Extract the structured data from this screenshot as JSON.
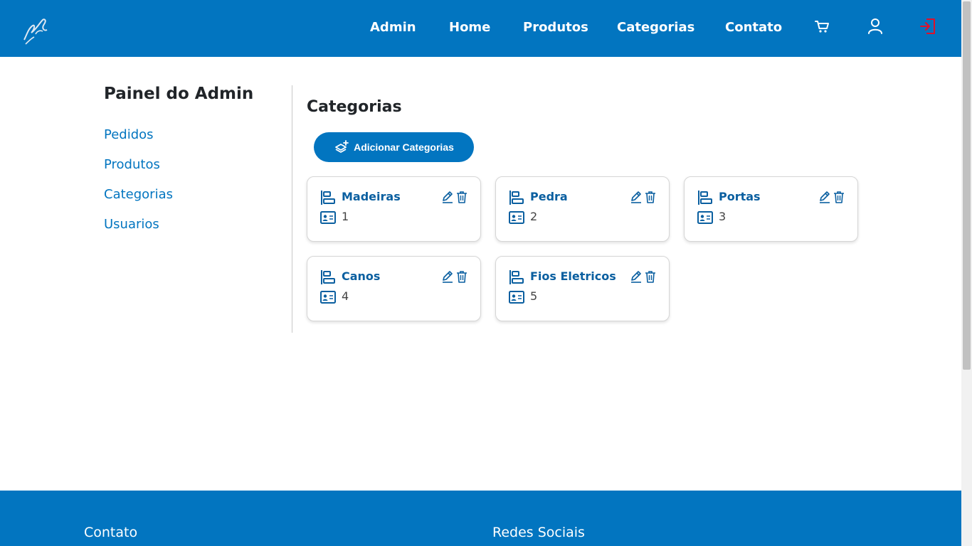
{
  "nav": {
    "items": [
      {
        "label": "Admin"
      },
      {
        "label": "Home"
      },
      {
        "label": "Produtos"
      },
      {
        "label": "Categorias"
      },
      {
        "label": "Contato"
      }
    ],
    "icons": [
      "cart-icon",
      "user-icon",
      "logout-icon"
    ],
    "logout_color": "#e0102a"
  },
  "sidebar": {
    "title": "Painel do Admin",
    "items": [
      {
        "label": "Pedidos"
      },
      {
        "label": "Produtos"
      },
      {
        "label": "Categorias"
      },
      {
        "label": "Usuarios"
      }
    ]
  },
  "main": {
    "title": "Categorias",
    "add_button_label": "Adicionar Categorias",
    "categories": [
      {
        "name": "Madeiras",
        "id": "1"
      },
      {
        "name": "Pedra",
        "id": "2"
      },
      {
        "name": "Portas",
        "id": "3"
      },
      {
        "name": "Canos",
        "id": "4"
      },
      {
        "name": "Fios Eletricos",
        "id": "5"
      }
    ]
  },
  "footer": {
    "contact_heading": "Contato",
    "social_heading": "Redes Sociais"
  },
  "colors": {
    "brand": "#0275c0",
    "card_title": "#0a5fa0"
  }
}
